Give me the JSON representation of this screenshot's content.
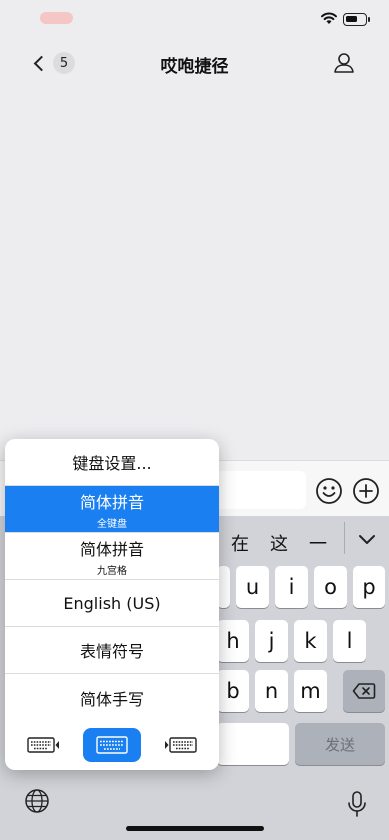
{
  "status_bar": {
    "battery_level": 0.6
  },
  "nav": {
    "badge": "5",
    "title": "哎咆捷径"
  },
  "candidates": [
    "在",
    "这",
    "一"
  ],
  "keyboard": {
    "row1_visible": [
      "u",
      "i",
      "o",
      "p"
    ],
    "row2_visible": [
      "h",
      "j",
      "k",
      "l"
    ],
    "row3_visible": [
      "b",
      "n",
      "m"
    ],
    "send_label": "发送"
  },
  "popup": {
    "settings_label": "键盘设置...",
    "items": [
      {
        "main": "简体拼音",
        "sub": "全键盘",
        "active": true
      },
      {
        "main": "简体拼音",
        "sub": "九宫格",
        "active": false
      },
      {
        "main": "English (US)",
        "sub": "",
        "active": false
      },
      {
        "main": "表情符号",
        "sub": "",
        "active": false
      },
      {
        "main": "简体手写",
        "sub": "",
        "active": false
      }
    ],
    "layout_options": [
      "keyboard-left-icon",
      "keyboard-full-icon",
      "keyboard-right-icon"
    ],
    "selected_layout": 1
  },
  "colors": {
    "accent": "#1a7ff0",
    "keyboard_bg": "#d1d3d9",
    "page_bg": "#ededf0"
  }
}
